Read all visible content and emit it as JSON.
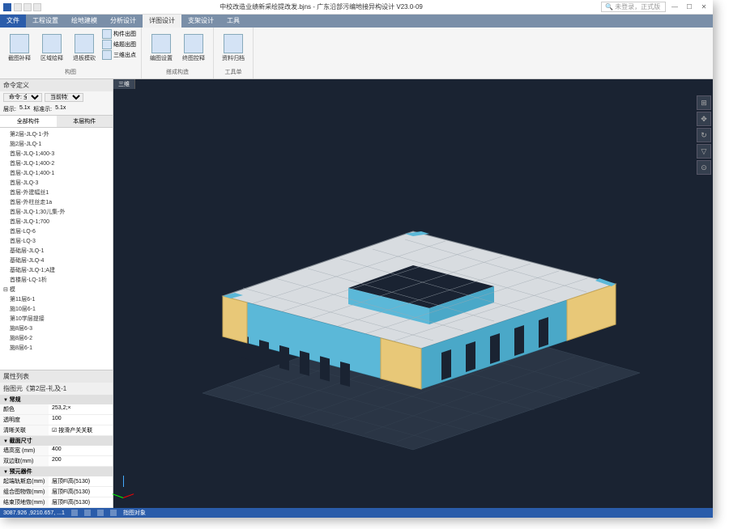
{
  "title_bar": {
    "document": "中校改造业绩新采绘提改发.bjns - 广东沿部污编地接异构设计 V23.0-09",
    "search_placeholder": "🔍 未登录，正式版"
  },
  "menu_tabs": [
    "文件",
    "工程设置",
    "绘地建模",
    "分析设计",
    "详图设计",
    "支架设计",
    "工具"
  ],
  "menu_active": 4,
  "ribbon": {
    "group1_label": "构图",
    "group1_btns": [
      "截图补释",
      "区域绘释",
      "退板模砍"
    ],
    "group1_side": [
      "构件出图",
      "结题出图",
      "三维出点"
    ],
    "group2_label": "搭成构造",
    "group2_btns": [
      "编图设置",
      "终图控释"
    ],
    "group3_label": "工具单",
    "group3_btns": [
      "资料归档"
    ]
  },
  "left_panel": {
    "title": "命令定义",
    "dropdown1": "命令: 全部",
    "dropdown2": "当前特造",
    "row2": {
      "k1": "层示:",
      "v1": "5.1x",
      "k2": "标准示:",
      "v2": "5.1x"
    },
    "tab1": "全部构件",
    "tab2": "本层构件",
    "tree": [
      "第2层-JLQ-1-外",
      "施2层-JLQ-1",
      "首层-JLQ-1;400-3",
      "首层-JLQ-1;400-2",
      "首层-JLQ-1;400-1",
      "首层-JLQ-3",
      "首层-外建幅丝1",
      "首层-外柱丝走1a",
      "首层-JLQ-1;30儿集-外",
      "首层-JLQ-1;700",
      "首层-LQ-6",
      "首层-LQ-3",
      "基础层-JLQ-1",
      "基础层-JLQ-4",
      "基础层-JLQ-1;A建",
      "首楼层-LQ-1析"
    ],
    "tree_section2": "模",
    "tree2": [
      "第11层6-1",
      "施10层6-1",
      "第10学层提接",
      "施8层6-3",
      "施8层6-2",
      "施8层6-1"
    ]
  },
  "props": {
    "title": "属性列表",
    "context": "指图元《第2层-礼及-1",
    "sections": [
      {
        "name": "常规",
        "rows": [
          {
            "k": "颜色",
            "v": "253,2;×"
          },
          {
            "k": "透明度",
            "v": "100"
          },
          {
            "k": "清晰关联",
            "v": "按滑产关关联"
          }
        ]
      },
      {
        "name": "截面尺寸",
        "rows": [
          {
            "k": "墙高宽 (mm)",
            "v": "400"
          },
          {
            "k": "双边取(mm)",
            "v": "200"
          }
        ]
      },
      {
        "name": "预元器件",
        "rows": [
          {
            "k": "起端轨斯启(mm)",
            "v": "层顶Fl高(5130)"
          },
          {
            "k": "组合图物恢(mm)",
            "v": "层顶Fl高(5130)"
          },
          {
            "k": "结束顶地恢(mm)",
            "v": "层顶Fl高(5130)"
          }
        ]
      }
    ]
  },
  "viewport": {
    "tabs": [
      "三维"
    ]
  },
  "status": {
    "coords": "3087.926 ,9210.657, ...1",
    "item2": "指图对象"
  }
}
